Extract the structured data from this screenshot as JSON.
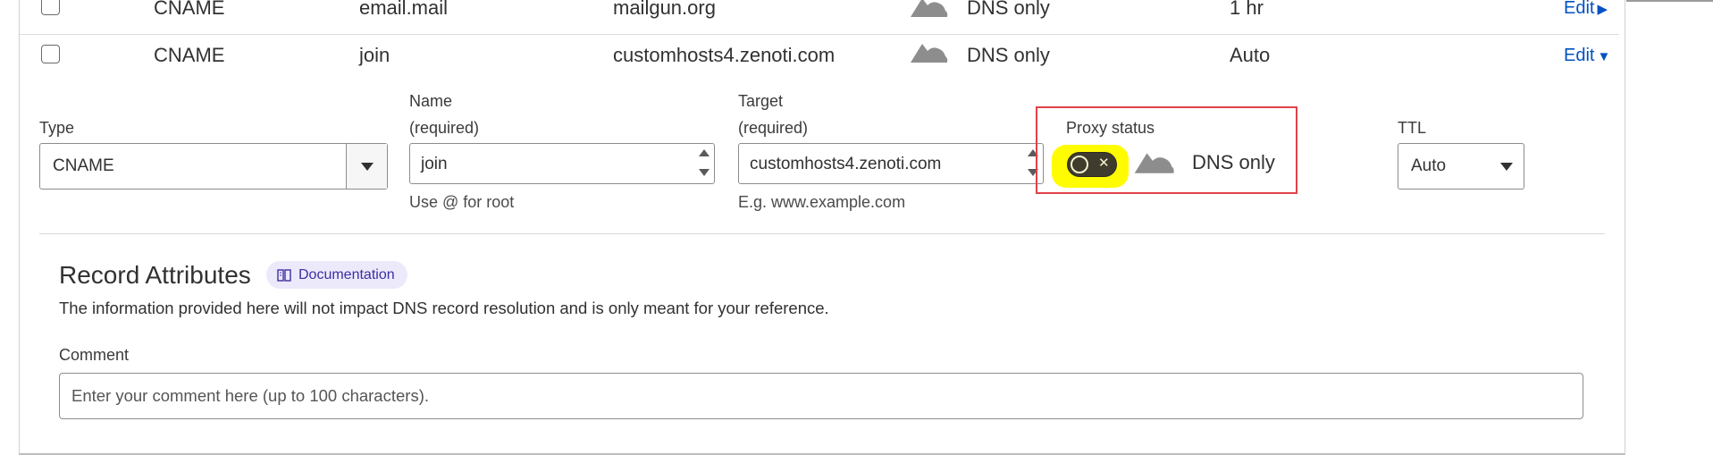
{
  "records": [
    {
      "type": "CNAME",
      "name": "email.mail",
      "content": "mailgun.org",
      "proxy": "DNS only",
      "ttl": "1 hr",
      "edit": "Edit",
      "edit_arrow": "▶"
    },
    {
      "type": "CNAME",
      "name": "join",
      "content": "customhosts4.zenoti.com",
      "proxy": "DNS only",
      "ttl": "Auto",
      "edit": "Edit",
      "edit_arrow": "▼"
    }
  ],
  "form": {
    "type_label": "Type",
    "type_value": "CNAME",
    "name_label": "Name",
    "name_required": "(required)",
    "name_value": "join",
    "name_hint": "Use @ for root",
    "target_label": "Target",
    "target_required": "(required)",
    "target_value": "customhosts4.zenoti.com",
    "target_hint": "E.g. www.example.com",
    "proxy_label": "Proxy status",
    "proxy_value": "DNS only",
    "proxy_toggle_mark": "✕",
    "proxy_enabled": false,
    "ttl_label": "TTL",
    "ttl_value": "Auto"
  },
  "attributes": {
    "title": "Record Attributes",
    "doc_label": "Documentation",
    "description": "The information provided here will not impact DNS record resolution and is only meant for your reference.",
    "comment_label": "Comment",
    "comment_placeholder": "Enter your comment here (up to 100 characters)."
  },
  "colors": {
    "link": "#0051c3",
    "highlight_box": "#e0424a",
    "highlight_marker": "#fffb00",
    "badge_bg": "#ece9fb",
    "cloud_grey": "#8d8d8d"
  }
}
